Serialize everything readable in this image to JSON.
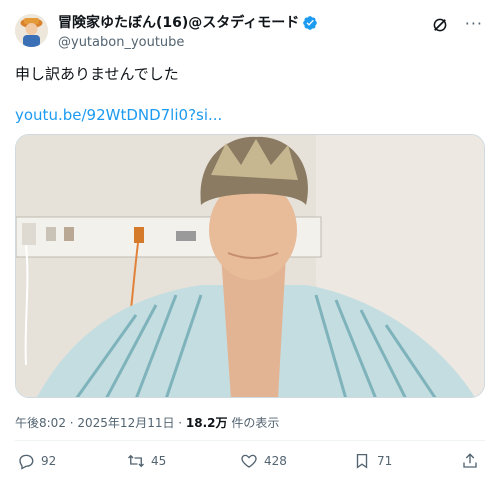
{
  "user": {
    "display_name": "冒険家ゆたぼん(16)@スタディモード",
    "handle": "@yutabon_youtube"
  },
  "icons": {
    "verified": "verified-badge-icon",
    "grok": "grok-icon",
    "more": "more-icon",
    "reply": "reply-icon",
    "retweet": "retweet-icon",
    "like": "like-icon",
    "bookmark": "bookmark-icon",
    "share": "share-icon"
  },
  "tweet": {
    "text": "申し訳ありませんでした",
    "link": "youtu.be/92WtDND7li0?si..."
  },
  "meta": {
    "time": "午後8:02 · 2025年12月11日 · ",
    "views_count": "18.2万",
    "views_label": " 件の表示"
  },
  "actions": {
    "replies": "92",
    "retweets": "45",
    "likes": "428",
    "bookmarks": "71"
  },
  "colors": {
    "accent": "#1d9bf0",
    "secondary_text": "#536471"
  }
}
